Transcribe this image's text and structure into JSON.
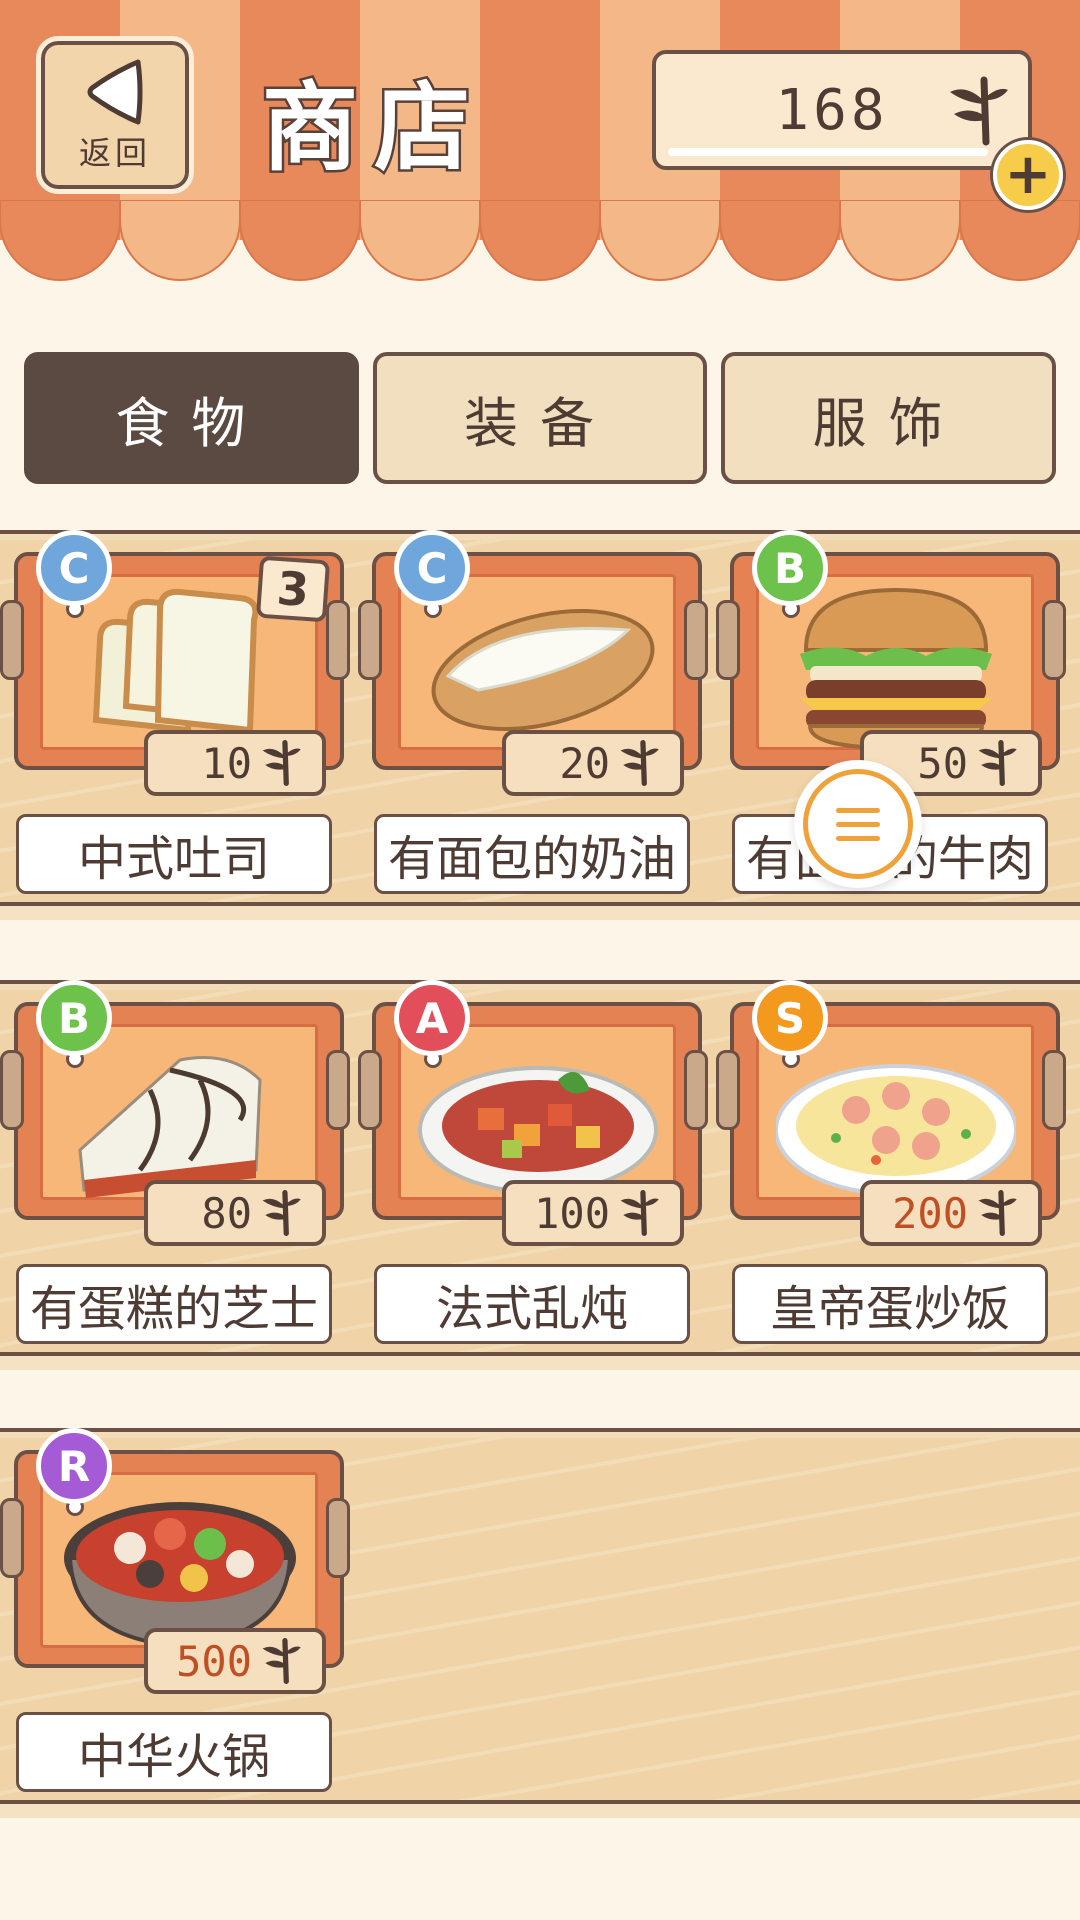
{
  "header": {
    "back_label": "返回",
    "title": "商店",
    "currency_amount": "168",
    "plus_label": "+"
  },
  "tabs": [
    {
      "label": "食物",
      "active": true
    },
    {
      "label": "装备",
      "active": false
    },
    {
      "label": "服饰",
      "active": false
    }
  ],
  "items": [
    {
      "grade": "C",
      "grade_color": "#6fa6dc",
      "count": "3",
      "price": "10",
      "name": "中式吐司",
      "food": "toast"
    },
    {
      "grade": "C",
      "grade_color": "#6fa6dc",
      "price": "20",
      "name": "有面包的奶油",
      "food": "hotdog"
    },
    {
      "grade": "B",
      "grade_color": "#6cc24a",
      "price": "50",
      "name": "有面包的牛肉",
      "food": "burger"
    },
    {
      "grade": "B",
      "grade_color": "#6cc24a",
      "price": "80",
      "name": "有蛋糕的芝士",
      "food": "cake"
    },
    {
      "grade": "A",
      "grade_color": "#e24f5b",
      "price": "100",
      "name": "法式乱炖",
      "food": "stew"
    },
    {
      "grade": "S",
      "grade_color": "#f39a1e",
      "price": "200",
      "name": "皇帝蛋炒饭",
      "food": "rice",
      "price_highlight": true
    },
    {
      "grade": "R",
      "grade_color": "#a55bd6",
      "price": "500",
      "name": "中华火锅",
      "food": "hotpot",
      "price_highlight": true
    }
  ],
  "colors": {
    "awning_dark": "#e8895c",
    "awning_light": "#f4b787",
    "tab_active": "#5b4a42",
    "price_highlight": "#c14f24"
  }
}
